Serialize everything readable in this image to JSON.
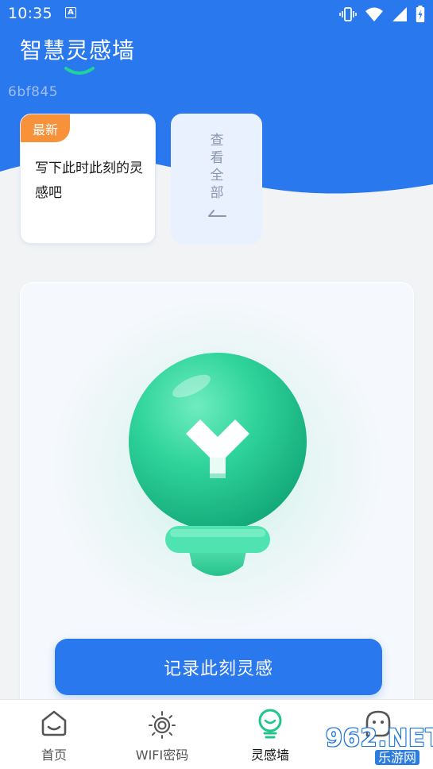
{
  "status_bar": {
    "time": "10:35",
    "notification_icon": "a-letter-icon",
    "icons": [
      "vibrate-icon",
      "wifi-icon",
      "signal-icon",
      "battery-charging-icon"
    ]
  },
  "header": {
    "title": "智慧灵感墙",
    "hex_code": "6bf845"
  },
  "latest_card": {
    "badge": "最新",
    "text": "写下此时此刻的灵感吧"
  },
  "view_all": {
    "label": "查看全部"
  },
  "main": {
    "illustration": "lightbulb-icon",
    "record_button": "记录此刻灵感"
  },
  "bottom_nav": {
    "items": [
      {
        "label": "首页",
        "icon": "home-icon",
        "active": false
      },
      {
        "label": "WIFI密码",
        "icon": "sun-icon",
        "active": false
      },
      {
        "label": "灵感墙",
        "icon": "bulb-icon",
        "active": true
      },
      {
        "label": "",
        "icon": "face-icon",
        "active": false
      }
    ]
  },
  "watermark": {
    "main": "962.NET",
    "sub": "乐游网"
  },
  "colors": {
    "primary_blue": "#2a78ee",
    "badge_orange": "#f7923a",
    "bulb_green": "#2dd197",
    "active_nav_green": "#21c48a"
  }
}
